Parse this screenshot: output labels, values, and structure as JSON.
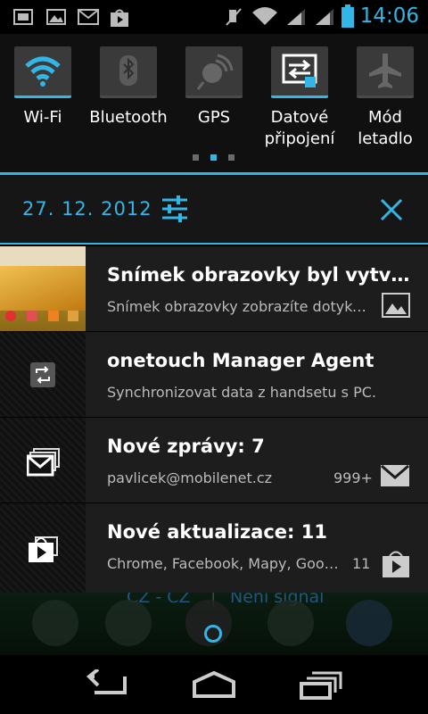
{
  "status_bar": {
    "time": "14:06",
    "left_icons": [
      "screenshot-icon",
      "gallery-icon",
      "gmail-icon",
      "play-store-icon"
    ],
    "right_icons": [
      "mute-icon",
      "wifi-icon",
      "signal-icon",
      "signal-icon",
      "battery-icon"
    ],
    "accent": "#33b5e5"
  },
  "quick_settings": {
    "tiles": [
      {
        "label": "Wi-Fi",
        "icon": "wifi-icon",
        "on": true
      },
      {
        "label": "Bluetooth",
        "icon": "bluetooth-icon",
        "on": false
      },
      {
        "label": "GPS",
        "icon": "gps-icon",
        "on": false
      },
      {
        "label": "Datové\npřipojení",
        "icon": "data-icon",
        "on": true
      },
      {
        "label": "Mód\nletadlo",
        "icon": "airplane-icon",
        "on": false
      }
    ],
    "page_indicator_active": 2,
    "page_count": 3
  },
  "header": {
    "date": "27. 12. 2012",
    "settings_icon": "settings-sliders-icon",
    "clear_icon": "close-icon"
  },
  "notifications": [
    {
      "title": "Snímek obrazovky byl vytvoře…",
      "text": "Snímek obrazovky zobrazíte dotyke…",
      "icon": "screenshot-thumbnail",
      "small_icon": "gallery-icon",
      "count": ""
    },
    {
      "title": "onetouch Manager Agent",
      "text": "Synchronizovat data z handsetu s PC.",
      "icon": "sync-icon",
      "small_icon": "",
      "count": ""
    },
    {
      "title": "Nové zprávy: 7",
      "text": "pavlicek@mobilenet.cz",
      "icon": "gmail-stack-icon",
      "small_icon": "gmail-icon",
      "count": "999+"
    },
    {
      "title": "Nové aktualizace: 11",
      "text": "Chrome, Facebook, Mapy, Goog…",
      "icon": "store-bag-icon",
      "small_icon": "play-store-icon",
      "count": "11"
    }
  ],
  "background": {
    "ghost_text_left": "CZ - CZ",
    "ghost_text_right": "Není signál"
  },
  "navbar": {
    "back": "back-icon",
    "home": "home-icon",
    "recents": "recents-icon"
  }
}
